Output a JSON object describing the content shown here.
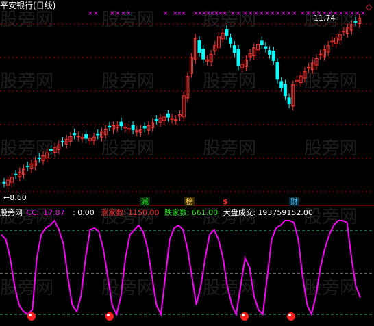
{
  "upper": {
    "title": "平安银行(日线)",
    "high_label": "11.74",
    "low_label": "8.60",
    "corner_icon": "diamond-outline-icon",
    "markers": {
      "jian": "減",
      "bang": "榜",
      "dollar": "$",
      "cai": "财"
    }
  },
  "lower": {
    "name": "股旁网",
    "cc_label": "CC:",
    "cc_value": "17.87",
    "zero_value": ": 0.00",
    "up_label": "涨家数:",
    "up_value": "1150.00",
    "down_label": "跌家数:",
    "down_value": "661.00",
    "vol_label": "大盘成交:",
    "vol_value": "193759152.00"
  },
  "watermark": "股旁网",
  "colors": {
    "up": "#ff3232",
    "down": "#00ffff",
    "cc_line": "#ff00ff",
    "grid": "#b40000"
  },
  "chart_data": [
    {
      "type": "candlestick",
      "title": "平安银行(日线)",
      "annotations": [
        "11.74",
        "8.60"
      ],
      "note": "daily candles; rise from ~8.6 to peak ~11.74"
    },
    {
      "type": "line",
      "series": [
        {
          "name": "CC",
          "last": 17.87
        }
      ],
      "grid": true
    }
  ]
}
